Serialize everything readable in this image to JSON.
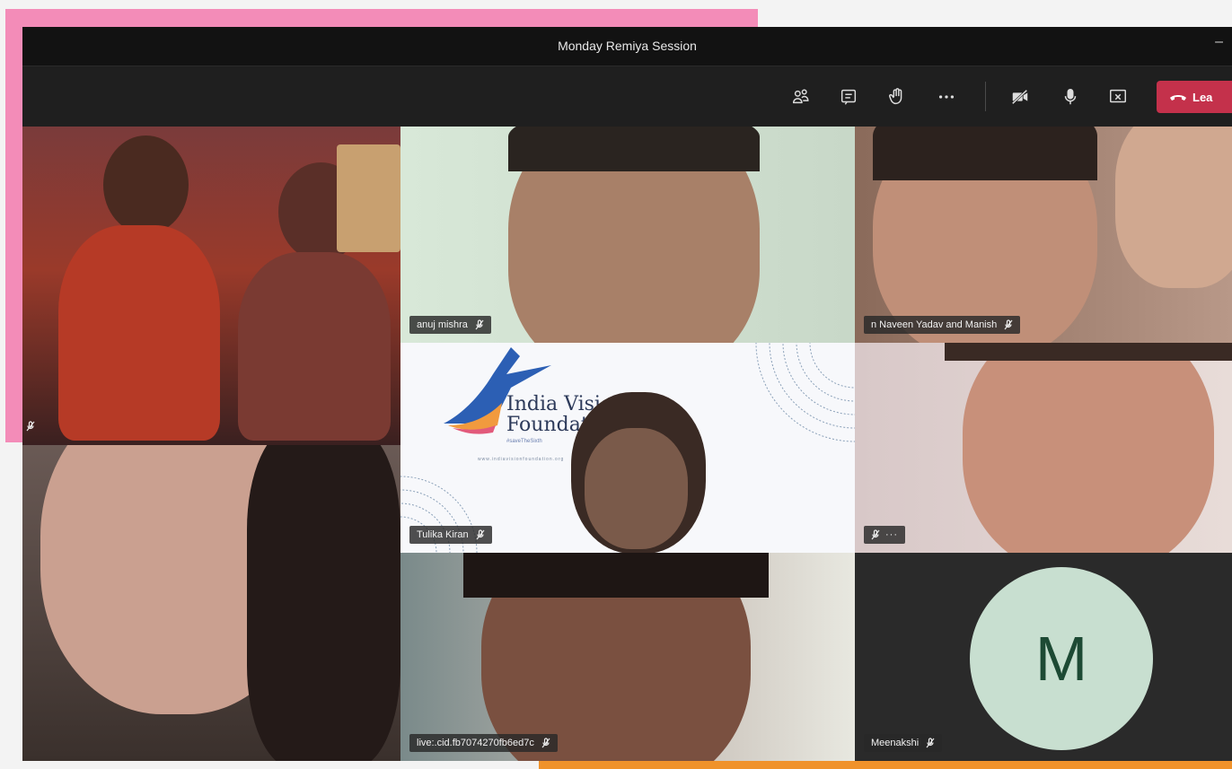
{
  "window": {
    "title": "Monday Remiya Session",
    "minimize": "–"
  },
  "toolbar": {
    "buttons": [
      {
        "name": "participants-icon"
      },
      {
        "name": "chat-icon"
      },
      {
        "name": "raise-hand-icon"
      },
      {
        "name": "more-actions-icon"
      },
      {
        "name": "camera-off-icon"
      },
      {
        "name": "microphone-icon"
      },
      {
        "name": "share-screen-icon"
      }
    ],
    "leave_label": "Lea",
    "leave_color": "#c4314b"
  },
  "participants": [
    {
      "name": "",
      "muted": true
    },
    {
      "name": "anuj mishra",
      "muted": true
    },
    {
      "name": "n Naveen Yadav and Manish",
      "muted": true
    },
    {
      "name": "",
      "muted": true
    },
    {
      "name": "Tulika Kiran",
      "muted": true
    },
    {
      "name": "",
      "muted": true,
      "more": "···"
    },
    {
      "name": "live:.cid.fb7074270fb6ed7c",
      "muted": true
    },
    {
      "name": "Meenakshi",
      "muted": true,
      "avatar_initial": "M"
    }
  ],
  "shared_logo": {
    "line1": "India Vision",
    "line2": "Foundatio",
    "tagline": "#saveTheSixth",
    "url": "www.indiavisionfoundation.org"
  },
  "colors": {
    "accent_pink": "#f38cb8",
    "accent_orange": "#f0922b",
    "avatar_bg": "#c8dfd0",
    "avatar_fg": "#1d4a34"
  }
}
